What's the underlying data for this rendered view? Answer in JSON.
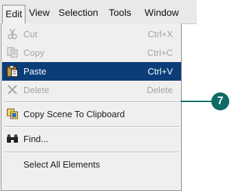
{
  "menubar": {
    "items": [
      {
        "label": "Edit"
      },
      {
        "label": "View"
      },
      {
        "label": "Selection"
      },
      {
        "label": "Tools"
      },
      {
        "label": "Window"
      }
    ]
  },
  "edit_menu": {
    "items": [
      {
        "label": "Cut",
        "shortcut": "Ctrl+X",
        "icon": "scissors-icon",
        "state": "disabled"
      },
      {
        "label": "Copy",
        "shortcut": "Ctrl+C",
        "icon": "copy-icon",
        "state": "disabled"
      },
      {
        "label": "Paste",
        "shortcut": "Ctrl+V",
        "icon": "clipboard-icon",
        "state": "selected"
      },
      {
        "label": "Delete",
        "shortcut": "Delete",
        "icon": "delete-x-icon",
        "state": "disabled"
      },
      {
        "label": "Copy Scene To Clipboard",
        "shortcut": "",
        "icon": "copy-scene-icon",
        "state": "enabled"
      },
      {
        "label": "Find...",
        "shortcut": "",
        "icon": "binoculars-icon",
        "state": "enabled"
      },
      {
        "label": "Select All Elements",
        "shortcut": "",
        "icon": "",
        "state": "enabled"
      }
    ]
  },
  "callout": {
    "number": "7",
    "color": "#0f6b66"
  },
  "colors": {
    "highlight": "#0b3d78",
    "menu_bg": "#efefef",
    "disabled_text": "#a3a3a3"
  }
}
